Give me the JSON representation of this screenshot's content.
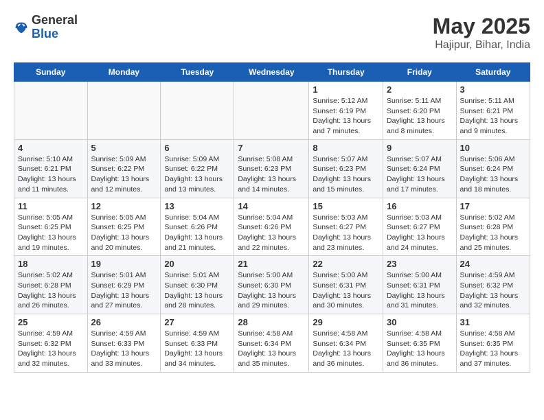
{
  "header": {
    "logo_line1": "General",
    "logo_line2": "Blue",
    "title": "May 2025",
    "subtitle": "Hajipur, Bihar, India"
  },
  "days_of_week": [
    "Sunday",
    "Monday",
    "Tuesday",
    "Wednesday",
    "Thursday",
    "Friday",
    "Saturday"
  ],
  "weeks": [
    [
      {
        "day": "",
        "info": ""
      },
      {
        "day": "",
        "info": ""
      },
      {
        "day": "",
        "info": ""
      },
      {
        "day": "",
        "info": ""
      },
      {
        "day": "1",
        "info": "Sunrise: 5:12 AM\nSunset: 6:19 PM\nDaylight: 13 hours\nand 7 minutes."
      },
      {
        "day": "2",
        "info": "Sunrise: 5:11 AM\nSunset: 6:20 PM\nDaylight: 13 hours\nand 8 minutes."
      },
      {
        "day": "3",
        "info": "Sunrise: 5:11 AM\nSunset: 6:21 PM\nDaylight: 13 hours\nand 9 minutes."
      }
    ],
    [
      {
        "day": "4",
        "info": "Sunrise: 5:10 AM\nSunset: 6:21 PM\nDaylight: 13 hours\nand 11 minutes."
      },
      {
        "day": "5",
        "info": "Sunrise: 5:09 AM\nSunset: 6:22 PM\nDaylight: 13 hours\nand 12 minutes."
      },
      {
        "day": "6",
        "info": "Sunrise: 5:09 AM\nSunset: 6:22 PM\nDaylight: 13 hours\nand 13 minutes."
      },
      {
        "day": "7",
        "info": "Sunrise: 5:08 AM\nSunset: 6:23 PM\nDaylight: 13 hours\nand 14 minutes."
      },
      {
        "day": "8",
        "info": "Sunrise: 5:07 AM\nSunset: 6:23 PM\nDaylight: 13 hours\nand 15 minutes."
      },
      {
        "day": "9",
        "info": "Sunrise: 5:07 AM\nSunset: 6:24 PM\nDaylight: 13 hours\nand 17 minutes."
      },
      {
        "day": "10",
        "info": "Sunrise: 5:06 AM\nSunset: 6:24 PM\nDaylight: 13 hours\nand 18 minutes."
      }
    ],
    [
      {
        "day": "11",
        "info": "Sunrise: 5:05 AM\nSunset: 6:25 PM\nDaylight: 13 hours\nand 19 minutes."
      },
      {
        "day": "12",
        "info": "Sunrise: 5:05 AM\nSunset: 6:25 PM\nDaylight: 13 hours\nand 20 minutes."
      },
      {
        "day": "13",
        "info": "Sunrise: 5:04 AM\nSunset: 6:26 PM\nDaylight: 13 hours\nand 21 minutes."
      },
      {
        "day": "14",
        "info": "Sunrise: 5:04 AM\nSunset: 6:26 PM\nDaylight: 13 hours\nand 22 minutes."
      },
      {
        "day": "15",
        "info": "Sunrise: 5:03 AM\nSunset: 6:27 PM\nDaylight: 13 hours\nand 23 minutes."
      },
      {
        "day": "16",
        "info": "Sunrise: 5:03 AM\nSunset: 6:27 PM\nDaylight: 13 hours\nand 24 minutes."
      },
      {
        "day": "17",
        "info": "Sunrise: 5:02 AM\nSunset: 6:28 PM\nDaylight: 13 hours\nand 25 minutes."
      }
    ],
    [
      {
        "day": "18",
        "info": "Sunrise: 5:02 AM\nSunset: 6:28 PM\nDaylight: 13 hours\nand 26 minutes."
      },
      {
        "day": "19",
        "info": "Sunrise: 5:01 AM\nSunset: 6:29 PM\nDaylight: 13 hours\nand 27 minutes."
      },
      {
        "day": "20",
        "info": "Sunrise: 5:01 AM\nSunset: 6:30 PM\nDaylight: 13 hours\nand 28 minutes."
      },
      {
        "day": "21",
        "info": "Sunrise: 5:00 AM\nSunset: 6:30 PM\nDaylight: 13 hours\nand 29 minutes."
      },
      {
        "day": "22",
        "info": "Sunrise: 5:00 AM\nSunset: 6:31 PM\nDaylight: 13 hours\nand 30 minutes."
      },
      {
        "day": "23",
        "info": "Sunrise: 5:00 AM\nSunset: 6:31 PM\nDaylight: 13 hours\nand 31 minutes."
      },
      {
        "day": "24",
        "info": "Sunrise: 4:59 AM\nSunset: 6:32 PM\nDaylight: 13 hours\nand 32 minutes."
      }
    ],
    [
      {
        "day": "25",
        "info": "Sunrise: 4:59 AM\nSunset: 6:32 PM\nDaylight: 13 hours\nand 32 minutes."
      },
      {
        "day": "26",
        "info": "Sunrise: 4:59 AM\nSunset: 6:33 PM\nDaylight: 13 hours\nand 33 minutes."
      },
      {
        "day": "27",
        "info": "Sunrise: 4:59 AM\nSunset: 6:33 PM\nDaylight: 13 hours\nand 34 minutes."
      },
      {
        "day": "28",
        "info": "Sunrise: 4:58 AM\nSunset: 6:34 PM\nDaylight: 13 hours\nand 35 minutes."
      },
      {
        "day": "29",
        "info": "Sunrise: 4:58 AM\nSunset: 6:34 PM\nDaylight: 13 hours\nand 36 minutes."
      },
      {
        "day": "30",
        "info": "Sunrise: 4:58 AM\nSunset: 6:35 PM\nDaylight: 13 hours\nand 36 minutes."
      },
      {
        "day": "31",
        "info": "Sunrise: 4:58 AM\nSunset: 6:35 PM\nDaylight: 13 hours\nand 37 minutes."
      }
    ]
  ]
}
